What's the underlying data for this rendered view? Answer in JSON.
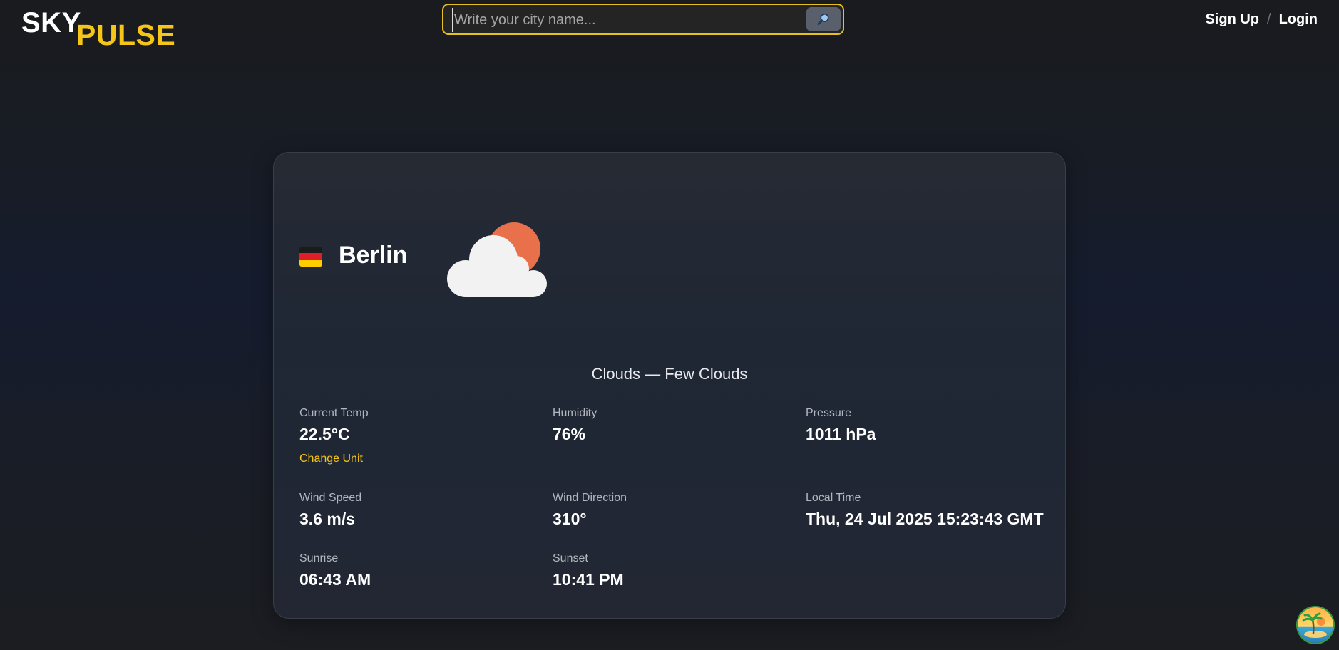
{
  "brand": {
    "word1": "SKY",
    "word2": "PULSE"
  },
  "search": {
    "placeholder": "Write your city name...",
    "value": "",
    "button_icon": "search-icon"
  },
  "auth": {
    "signup_label": "Sign Up",
    "separator": "/",
    "login_label": "Login"
  },
  "weather": {
    "flag_icon": "germany-flag-icon",
    "city": "Berlin",
    "condition_icon": "partly-cloudy-icon",
    "description": "Clouds — Few Clouds",
    "stats": {
      "current_temp": {
        "label": "Current Temp",
        "value": "22.5°C"
      },
      "change_unit_label": "Change Unit",
      "humidity": {
        "label": "Humidity",
        "value": "76%"
      },
      "pressure": {
        "label": "Pressure",
        "value": "1011 hPa"
      },
      "wind_speed": {
        "label": "Wind Speed",
        "value": "3.6 m/s"
      },
      "wind_direction": {
        "label": "Wind Direction",
        "value": "310°"
      },
      "local_time": {
        "label": "Local Time",
        "value": "Thu, 24 Jul 2025 15:23:43 GMT"
      },
      "sunrise": {
        "label": "Sunrise",
        "value": "06:43 AM"
      },
      "sunset": {
        "label": "Sunset",
        "value": "10:41 PM"
      }
    }
  },
  "floating_button_icon": "beach-island-icon",
  "colors": {
    "accent": "#f5c518",
    "sun": "#e8704a",
    "cloud": "#f2f2f2"
  }
}
